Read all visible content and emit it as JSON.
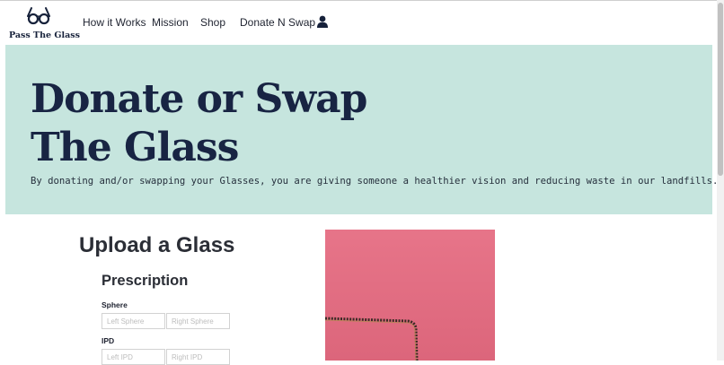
{
  "brand": {
    "name": "Pass The Glass"
  },
  "nav": {
    "links": [
      {
        "label": "How it Works"
      },
      {
        "label": "Mission"
      },
      {
        "label": "Shop"
      },
      {
        "label": "Donate N Swap"
      }
    ]
  },
  "hero": {
    "title_line1": "Donate or Swap",
    "title_line2": "The Glass",
    "subtitle": "By donating and/or swapping your Glasses, you are giving someone a healthier vision and reducing waste in our landfills."
  },
  "upload": {
    "title": "Upload a Glass",
    "prescription_title": "Prescription",
    "sphere_label": "Sphere",
    "left_sphere_placeholder": "Left Sphere",
    "right_sphere_placeholder": "Right Sphere",
    "ipd_label": "IPD",
    "left_ipd_placeholder": "Left IPD",
    "right_ipd_placeholder": "Right IPD"
  },
  "colors": {
    "hero_bg": "#c6e5de",
    "heading": "#182443",
    "photo_bg": "#e56a80"
  }
}
